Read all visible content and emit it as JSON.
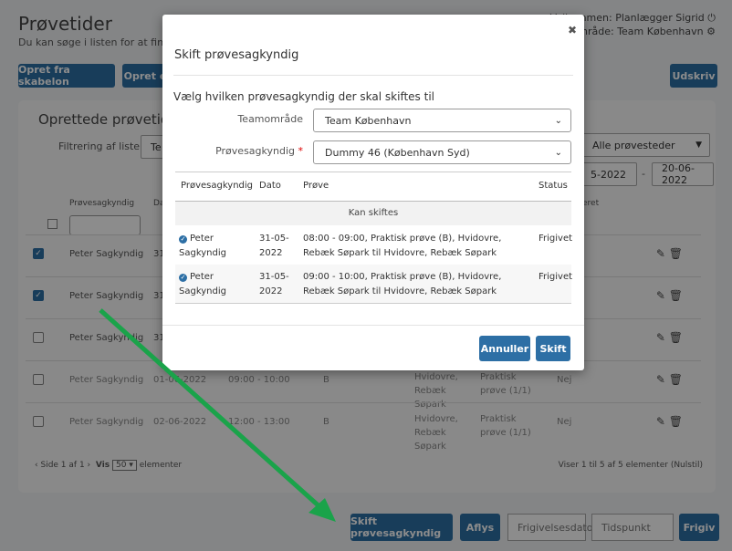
{
  "page": {
    "title": "Prøvetider",
    "subtitle": "Du kan søge i listen for at finde e",
    "welcome": "Velkommen: Planlægger Sigrid",
    "team_area": "Teamområde: Team København",
    "buttons": {
      "create_from_template": "Opret fra skabelon",
      "create": "Opret e",
      "print": "Udskriv"
    },
    "card_title": "Oprettede prøvetider",
    "filter_label": "Filtrering af liste:",
    "filter_value": "Te",
    "location_filter": "Alle prøvesteder",
    "date_from": "5-2022",
    "date_to": "20-06-2022",
    "columns": {
      "examiner": "Prøvesagkyndig",
      "date": "Da",
      "released": "eret"
    },
    "rows": [
      {
        "examiner": "Peter Sagkyndig",
        "date": "31",
        "checked": true
      },
      {
        "examiner": "Peter Sagkyndig",
        "date": "31",
        "checked": true
      },
      {
        "examiner": "Peter Sagkyndig",
        "date": "31",
        "checked": false
      },
      {
        "examiner": "Peter Sagkyndig",
        "date": "01-06-2022",
        "time": "09:00 - 10:00",
        "cat": "B",
        "place": "Hvidovre, Rebæk Søpark",
        "test": "Praktisk prøve (1/1)",
        "released": "Nej",
        "checked": false
      },
      {
        "examiner": "Peter Sagkyndig",
        "date": "02-06-2022",
        "time": "12:00 - 13:00",
        "cat": "B",
        "place": "Hvidovre, Rebæk Søpark",
        "test": "Praktisk prøve (1/1)",
        "released": "Nej",
        "checked": false
      }
    ],
    "pager": {
      "page": "Side 1 af 1",
      "show": "Vis",
      "per_page": "50",
      "elements": "elementer"
    },
    "pager_info": "Viser 1 til 5 af 5 elementer",
    "reset": "(Nulstil)",
    "bottom": {
      "change_examiner": "Skift prøvesagkyndig",
      "cancel": "Aflys",
      "release_date_placeholder": "Frigivelsesdato",
      "time_placeholder": "Tidspunkt",
      "release": "Frigiv"
    }
  },
  "modal": {
    "title": "Skift prøvesagkyndig",
    "prompt": "Vælg hvilken prøvesagkyndig der skal skiftes til",
    "team_label": "Teamområde",
    "team_value": "Team København",
    "examiner_label": "Prøvesagkyndig",
    "examiner_required": "*",
    "examiner_value": "Dummy 46 (København Syd)",
    "table": {
      "headers": [
        "Prøvesagkyndig",
        "Dato",
        "Prøve",
        "Status"
      ],
      "group": "Kan skiftes",
      "rows": [
        {
          "examiner": "Peter Sagkyndig",
          "date": "31-05-2022",
          "test": "08:00 - 09:00, Praktisk prøve (B), Hvidovre, Rebæk Søpark til Hvidovre, Rebæk Søpark",
          "status": "Frigivet"
        },
        {
          "examiner": "Peter Sagkyndig",
          "date": "31-05-2022",
          "test": "09:00 - 10:00, Praktisk prøve (B), Hvidovre, Rebæk Søpark til Hvidovre, Rebæk Søpark",
          "status": "Frigivet"
        }
      ]
    },
    "cancel": "Annuller",
    "submit": "Skift"
  },
  "colors": {
    "primary": "#2d6fa5",
    "arrow": "#1aa34a"
  }
}
